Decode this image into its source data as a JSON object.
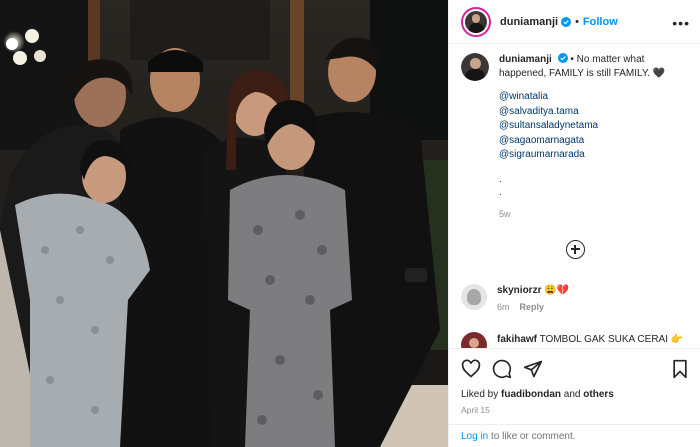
{
  "post": {
    "username": "duniamanji",
    "follow_label": "Follow",
    "separator": "•",
    "caption_text": "• No matter what happened, FAMILY is still FAMILY. 🖤",
    "mentions": [
      "@winatalia",
      "@salvaditya.tama",
      "@sultansaladynetama",
      "@sagaomarnagata",
      "@sigraumarnarada"
    ],
    "caption_dots": [
      ".",
      "."
    ],
    "age": "5w"
  },
  "comments": [
    {
      "username": "skyniorzr",
      "text": "😩💔",
      "age": "6m",
      "reply_label": "Reply"
    },
    {
      "username": "fakihawf",
      "text": "TOMBOL GAK SUKA CERAI 👉"
    }
  ],
  "likes": {
    "prefix": "Liked by ",
    "user": "fuadibondan",
    "joiner": " and ",
    "others": "others"
  },
  "date": "April 15",
  "login": {
    "link": "Log in",
    "rest": " to like or comment."
  },
  "icons": [
    "verified-icon",
    "more-icon",
    "heart-icon",
    "comment-icon",
    "share-icon",
    "bookmark-icon",
    "load-more-icon"
  ],
  "colors": {
    "accent": "#0095f6",
    "mention": "#00376b",
    "muted": "#8e8e8e"
  }
}
